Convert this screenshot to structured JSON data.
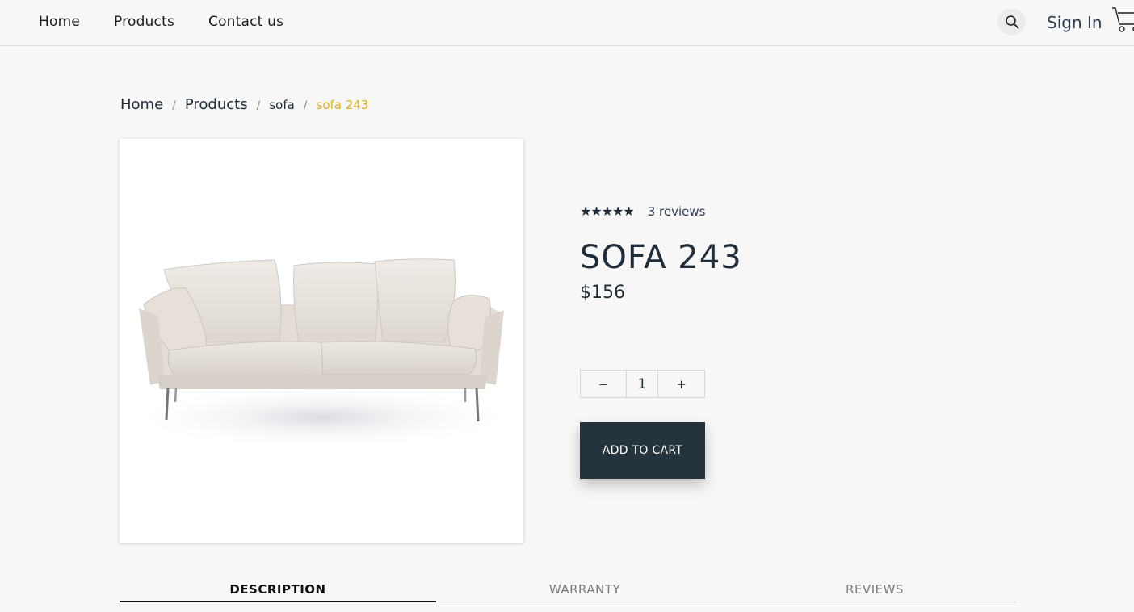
{
  "nav": {
    "home": "Home",
    "products": "Products",
    "contact": "Contact us",
    "sign_in": "Sign In"
  },
  "breadcrumb": {
    "items": [
      "Home",
      "Products",
      "sofa",
      "sofa 243"
    ],
    "separator": "/"
  },
  "product": {
    "rating_stars": "★★★★★",
    "rating_value": 5,
    "reviews": "3 reviews",
    "title": "SOFA 243",
    "price": "$156",
    "quantity": "1",
    "minus": "−",
    "plus": "+",
    "add_to_cart": "ADD TO CART"
  },
  "tabs": {
    "description": "DESCRIPTION",
    "warranty": "WARRANTY",
    "reviews": "REVIEWS",
    "active": "DESCRIPTION"
  },
  "icons": {
    "search": "search-icon",
    "cart": "cart-icon"
  },
  "colors": {
    "background": "#f7f7f7",
    "text_dark": "#1f2d3a",
    "breadcrumb_active": "#e0b11a",
    "button_dark": "#25333d"
  }
}
